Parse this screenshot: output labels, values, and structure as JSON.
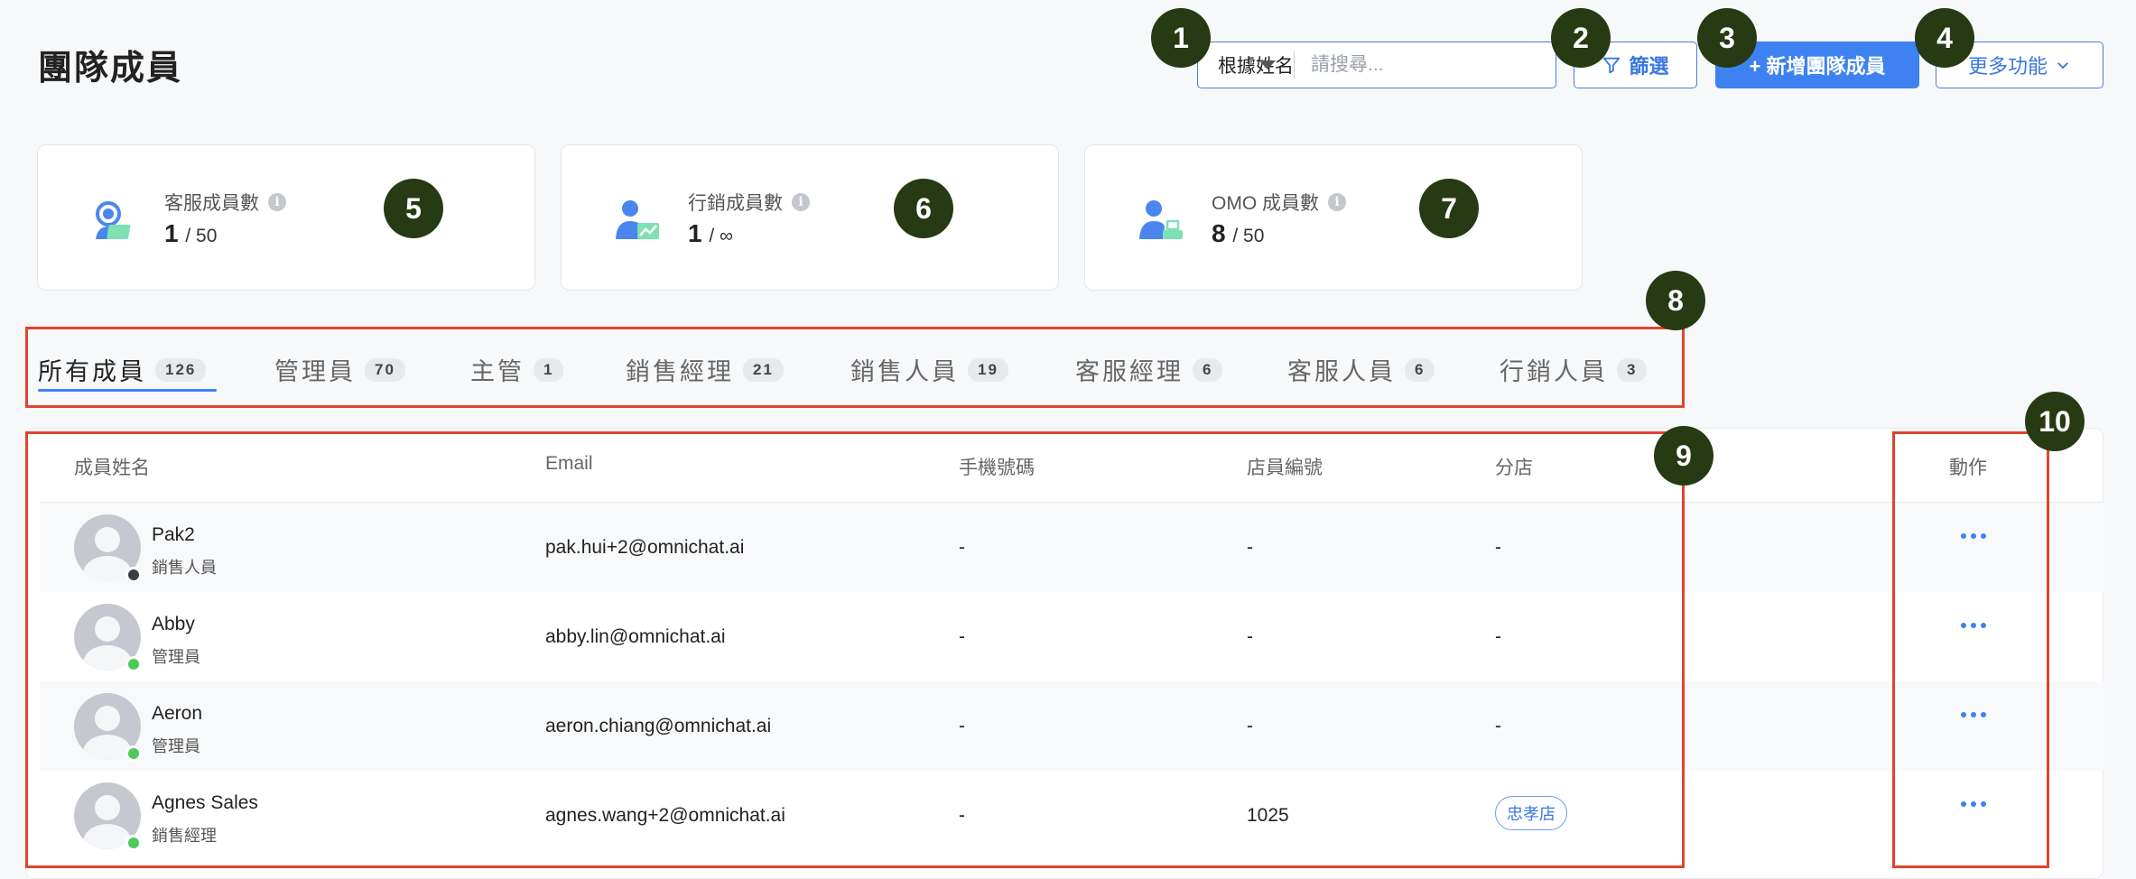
{
  "page": {
    "title": "團隊成員"
  },
  "toolbar": {
    "search_select_value": "根據姓名",
    "search_placeholder": "請搜尋...",
    "filter_label": "篩選",
    "add_member_label": "+ 新增團隊成員",
    "more_label": "更多功能"
  },
  "markers": [
    "1",
    "2",
    "3",
    "4",
    "5",
    "6",
    "7",
    "8",
    "9",
    "10"
  ],
  "stats": [
    {
      "label": "客服成員數",
      "value": "1",
      "total": "/ 50",
      "icon": "customer-service-icon"
    },
    {
      "label": "行銷成員數",
      "value": "1",
      "total": "/ ∞",
      "icon": "marketing-icon"
    },
    {
      "label": "OMO 成員數",
      "value": "8",
      "total": "/ 50",
      "icon": "omo-icon"
    }
  ],
  "tabs": [
    {
      "label": "所有成員",
      "count": "126"
    },
    {
      "label": "管理員",
      "count": "70"
    },
    {
      "label": "主管",
      "count": "1"
    },
    {
      "label": "銷售經理",
      "count": "21"
    },
    {
      "label": "銷售人員",
      "count": "19"
    },
    {
      "label": "客服經理",
      "count": "6"
    },
    {
      "label": "客服人員",
      "count": "6"
    },
    {
      "label": "行銷人員",
      "count": "3"
    }
  ],
  "table": {
    "columns": [
      "成員姓名",
      "Email",
      "手機號碼",
      "店員編號",
      "分店",
      "動作"
    ],
    "rows": [
      {
        "name": "Pak2",
        "role": "銷售人員",
        "email": "pak.hui+2@omnichat.ai",
        "phone": "-",
        "staff_id": "-",
        "branch": "-",
        "status_color": "#3a3d45"
      },
      {
        "name": "Abby",
        "role": "管理員",
        "email": "abby.lin@omnichat.ai",
        "phone": "-",
        "staff_id": "-",
        "branch": "-",
        "status_color": "#4cc95a"
      },
      {
        "name": "Aeron",
        "role": "管理員",
        "email": "aeron.chiang@omnichat.ai",
        "phone": "-",
        "staff_id": "-",
        "branch": "-",
        "status_color": "#4cc95a"
      },
      {
        "name": "Agnes Sales",
        "role": "銷售經理",
        "email": "agnes.wang+2@omnichat.ai",
        "phone": "-",
        "staff_id": "1025",
        "branch": "忠孝店",
        "status_color": "#4cc95a"
      }
    ]
  },
  "colors": {
    "accent": "#3d82f0",
    "marker": "#263a13",
    "highlight": "#e0442e",
    "online": "#4cc95a",
    "offline": "#3a3d45"
  }
}
